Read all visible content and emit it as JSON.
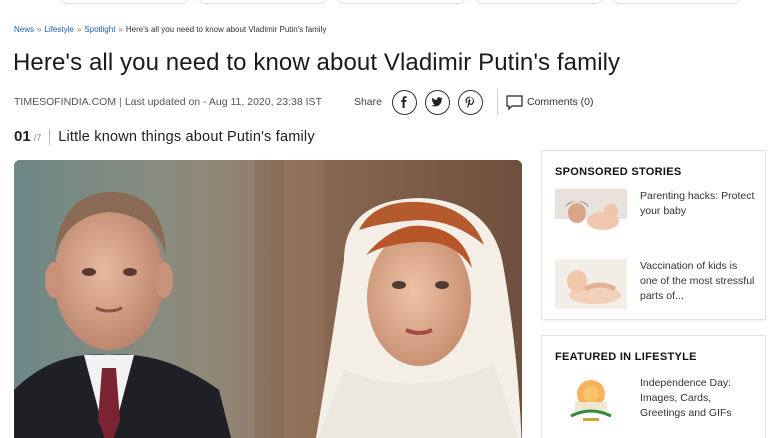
{
  "breadcrumb": {
    "items": [
      "News",
      "Lifestyle",
      "Spotlight"
    ],
    "separator": "»",
    "current": "Here's all you need to know about Vladimir Putin's family"
  },
  "article": {
    "title": "Here's all you need to know about Vladimir Putin's family",
    "source": "TIMESOFINDIA.COM",
    "updated": "Last updated on - Aug 11, 2020, 23:38 IST",
    "share_label": "Share",
    "share_buttons": [
      {
        "icon": "facebook-icon"
      },
      {
        "icon": "twitter-icon"
      },
      {
        "icon": "pinterest-icon"
      }
    ],
    "comments_label": "Comments (0)"
  },
  "slide": {
    "number": "01",
    "total": "/7",
    "title": "Little known things about Putin's family"
  },
  "sidebar": {
    "sponsored": {
      "title": "SPONSORED STORIES",
      "items": [
        {
          "text": "Parenting hacks: Protect your baby",
          "thumb": "mother-baby-photo"
        },
        {
          "text": "Vaccination of kids is one of the most stressful parts of...",
          "thumb": "baby-photo"
        }
      ]
    },
    "featured": {
      "title": "FEATURED IN LIFESTYLE",
      "items": [
        {
          "text": "Independence Day: Images, Cards, Greetings and GIFs",
          "thumb": "independence-day-card"
        }
      ]
    }
  },
  "colors": {
    "link": "#1a5fb4",
    "text": "#222222"
  }
}
